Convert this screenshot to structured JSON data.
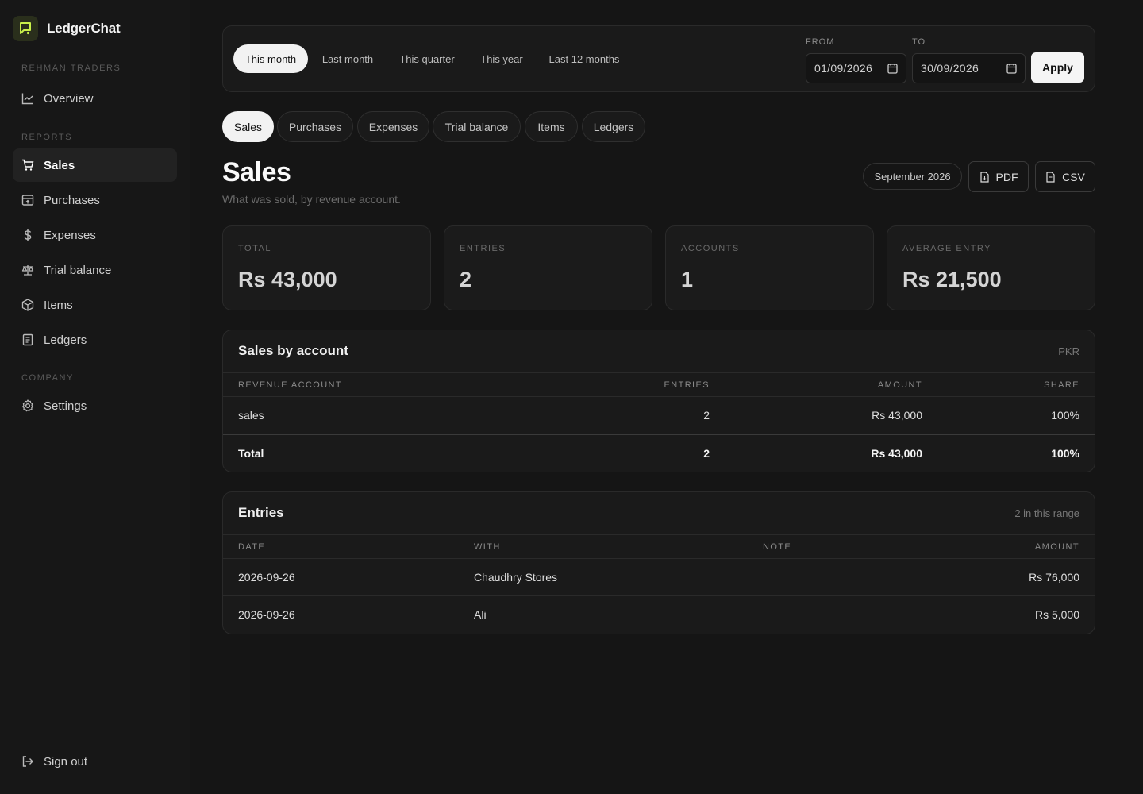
{
  "brand": {
    "name": "LedgerChat"
  },
  "sidebar": {
    "company": "REHMAN TRADERS",
    "overview": "Overview",
    "reports_label": "REPORTS",
    "items": [
      {
        "label": "Sales",
        "icon": "cart-icon"
      },
      {
        "label": "Purchases",
        "icon": "box-icon"
      },
      {
        "label": "Expenses",
        "icon": "dollar-icon"
      },
      {
        "label": "Trial balance",
        "icon": "scale-icon"
      },
      {
        "label": "Items",
        "icon": "cube-icon"
      },
      {
        "label": "Ledgers",
        "icon": "book-icon"
      }
    ],
    "company_label": "COMPANY",
    "settings": "Settings",
    "sign_out": "Sign out"
  },
  "filters": {
    "ranges": [
      "This month",
      "Last month",
      "This quarter",
      "This year",
      "Last 12 months"
    ],
    "from_label": "FROM",
    "from_value": "01/09/2026",
    "to_label": "TO",
    "to_value": "30/09/2026",
    "apply": "Apply"
  },
  "tabs": [
    "Sales",
    "Purchases",
    "Expenses",
    "Trial balance",
    "Items",
    "Ledgers"
  ],
  "page": {
    "title": "Sales",
    "subtitle": "What was sold, by revenue account.",
    "period": "September 2026",
    "pdf": "PDF",
    "csv": "CSV"
  },
  "stats": [
    {
      "label": "TOTAL",
      "value": "Rs 43,000"
    },
    {
      "label": "ENTRIES",
      "value": "2"
    },
    {
      "label": "ACCOUNTS",
      "value": "1"
    },
    {
      "label": "AVERAGE ENTRY",
      "value": "Rs 21,500"
    }
  ],
  "by_account": {
    "title": "Sales by account",
    "currency": "PKR",
    "headers": [
      "REVENUE ACCOUNT",
      "ENTRIES",
      "AMOUNT",
      "SHARE"
    ],
    "rows": [
      {
        "account": "sales",
        "entries": "2",
        "amount": "Rs 43,000",
        "share": "100%"
      }
    ],
    "total": {
      "label": "Total",
      "entries": "2",
      "amount": "Rs 43,000",
      "share": "100%"
    }
  },
  "entries": {
    "title": "Entries",
    "meta": "2 in this range",
    "headers": [
      "DATE",
      "WITH",
      "NOTE",
      "AMOUNT"
    ],
    "rows": [
      {
        "date": "2026-09-26",
        "with": "Chaudhry Stores",
        "note": "",
        "amount": "Rs 76,000"
      },
      {
        "date": "2026-09-26",
        "with": "Ali",
        "note": "",
        "amount": "Rs 5,000"
      }
    ]
  },
  "colors": {
    "accent": "#c8f04a",
    "background": "#151515"
  }
}
